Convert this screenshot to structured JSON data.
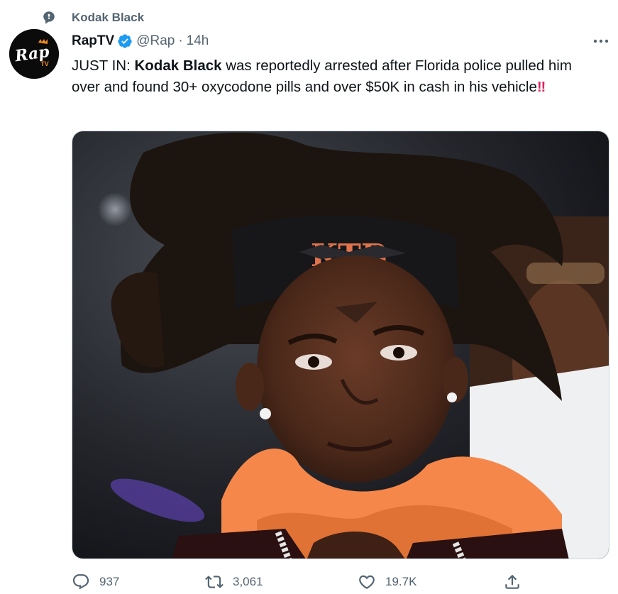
{
  "topic": {
    "label": "Kodak Black",
    "icon": "topic-speech-icon"
  },
  "author": {
    "avatar_text": "Rap",
    "avatar_sub": "TV",
    "display_name": "RapTV",
    "verified": true,
    "handle": "@Rap",
    "separator": "·",
    "time": "14h"
  },
  "tweet": {
    "prefix": "JUST IN: ",
    "bold_name": "Kodak Black",
    "body": " was reportedly arrested after Florida police pulled him over and found 30+ oxycodone pills and over $50K in cash in his vehicle",
    "emoji": "‼"
  },
  "media": {
    "type": "photo",
    "headband_text": "KTB"
  },
  "actions": {
    "reply_count": "937",
    "retweet_count": "3,061",
    "like_count": "19.7K"
  },
  "colors": {
    "verified": "#1d9bf0",
    "muted": "#536471",
    "text": "#0f1419",
    "alarm": "#e0245e"
  }
}
